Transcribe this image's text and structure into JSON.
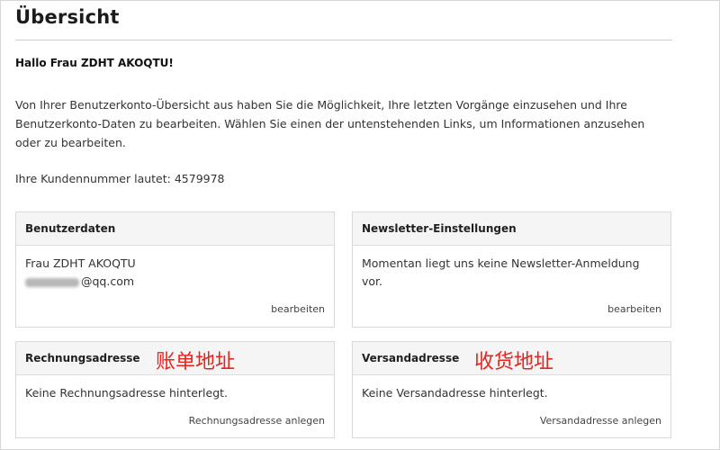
{
  "page": {
    "title": "Übersicht",
    "greeting": "Hallo Frau ZDHT AKOQTU!",
    "intro": "Von Ihrer Benutzerkonto-Übersicht aus haben Sie die Möglichkeit, Ihre letzten Vorgänge einzusehen und Ihre Benutzerkonto-Daten zu bearbeiten. Wählen Sie einen der untenstehenden Links, um Informationen anzusehen oder zu bearbeiten.",
    "customer_number": "Ihre Kundennummer lautet: 4579978"
  },
  "boxes": {
    "user_data": {
      "title": "Benutzerdaten",
      "name": "Frau ZDHT AKOQTU",
      "email_suffix": "@qq.com",
      "action": "bearbeiten"
    },
    "newsletter": {
      "title": "Newsletter-Einstellungen",
      "text": "Momentan liegt uns keine Newsletter-Anmeldung vor.",
      "action": "bearbeiten"
    },
    "billing": {
      "title": "Rechnungsadresse",
      "annotation": "账单地址",
      "text": "Keine Rechnungsadresse hinterlegt.",
      "action": "Rechnungsadresse anlegen"
    },
    "shipping": {
      "title": "Versandadresse",
      "annotation": "收货地址",
      "text": "Keine Versandadresse hinterlegt.",
      "action": "Versandadresse anlegen"
    }
  },
  "colors": {
    "annotation": "#e8241c",
    "box_header_bg": "#f5f5f5",
    "border": "#d9d9d9"
  }
}
